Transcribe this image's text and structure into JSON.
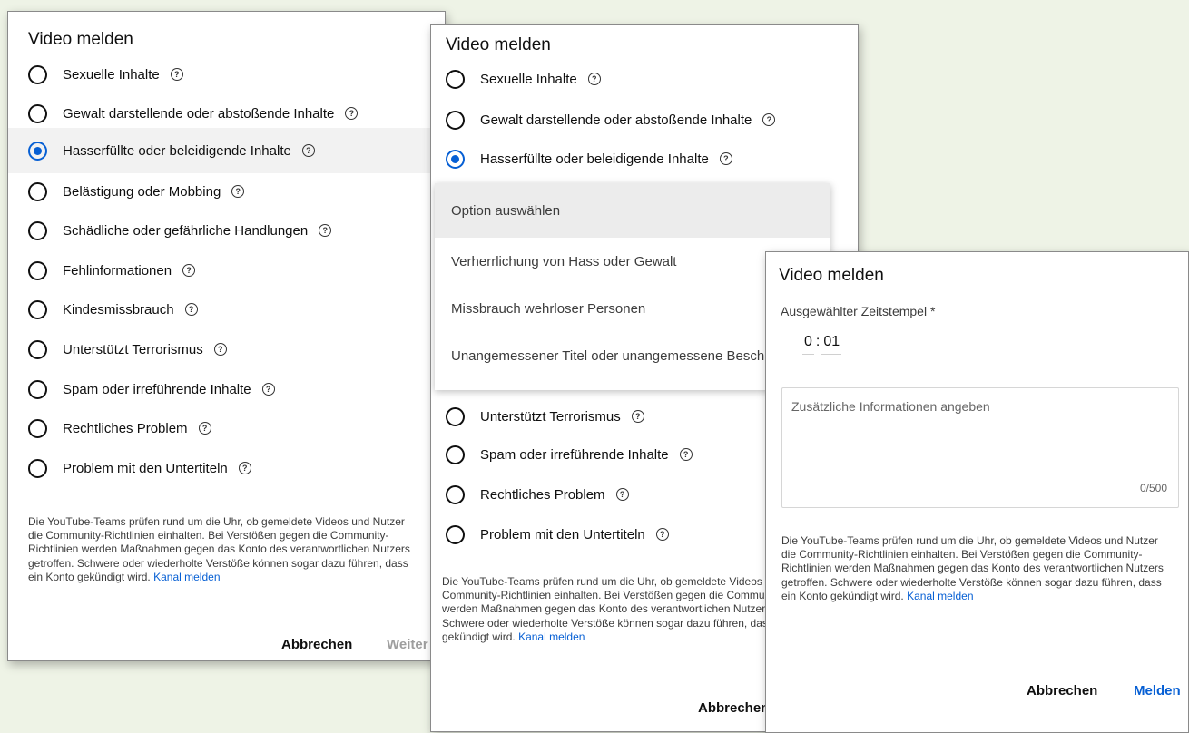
{
  "dialog_title": "Video melden",
  "help_glyph": "?",
  "options": [
    "Sexuelle Inhalte",
    "Gewalt darstellende oder abstoßende Inhalte",
    "Hasserfüllte oder beleidigende Inhalte",
    "Belästigung oder Mobbing",
    "Schädliche oder gefährliche Handlungen",
    "Fehlinformationen",
    "Kindesmissbrauch",
    "Unterstützt Terrorismus",
    "Spam oder irreführende Inhalte",
    "Rechtliches Problem",
    "Problem mit den Untertiteln"
  ],
  "selected_option": "Hasserfüllte oder beleidigende Inhalte",
  "disclaimer": "Die YouTube-Teams prüfen rund um die Uhr, ob gemeldete Videos und Nutzer die Community-Richtlinien einhalten. Bei Verstößen gegen die Community-Richtlinien werden Maßnahmen gegen das Konto des verantwortlichen Nutzers getroffen. Schwere oder wiederholte Verstöße können sogar dazu führen, dass ein Konto gekündigt wird.",
  "report_channel_link": "Kanal melden",
  "buttons": {
    "cancel": "Abbrechen",
    "next": "Weiter",
    "submit": "Melden"
  },
  "dropdown": {
    "header": "Option auswählen",
    "items": [
      "Verherrlichung von Hass oder Gewalt",
      "Missbrauch wehrloser Personen",
      "Unangemessener Titel oder unangemessene Beschreibung"
    ]
  },
  "timestamp": {
    "label": "Ausgewählter Zeitstempel *",
    "minutes": "0",
    "separator": ":",
    "seconds": "01"
  },
  "additional_info": {
    "placeholder": "Zusätzliche Informationen angeben",
    "counter": "0/500"
  },
  "colors": {
    "accent": "#065fd4",
    "background": "#eef3e6",
    "selected_row": "#f2f2f2"
  }
}
